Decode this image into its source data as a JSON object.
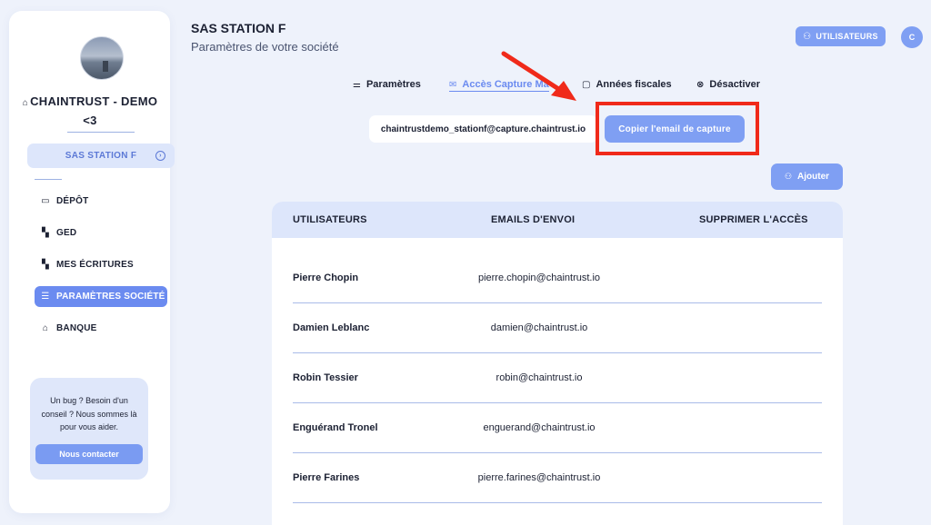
{
  "sidebar": {
    "company_name": "CHAINTRUST - DEMO <3",
    "selected_company": "SAS STATION F",
    "nav": [
      {
        "label": "DÉPÔT",
        "icon": "folder-icon",
        "active": false
      },
      {
        "label": "GED",
        "icon": "document-icon",
        "active": false
      },
      {
        "label": "MES ÉCRITURES",
        "icon": "document-icon",
        "active": false
      },
      {
        "label": "PARAMÈTRES SOCIÉTÉ",
        "icon": "sliders-icon",
        "active": true
      },
      {
        "label": "BANQUE",
        "icon": "bank-icon",
        "active": false
      }
    ],
    "help": {
      "text": "Un bug ? Besoin d'un conseil ? Nous sommes là pour vous aider.",
      "button": "Nous contacter"
    }
  },
  "header": {
    "title": "SAS STATION F",
    "subtitle": "Paramètres de votre société",
    "users_button": "UTILISATEURS",
    "user_initial": "C"
  },
  "tabs": [
    {
      "label": "Paramètres",
      "icon": "sliders-icon",
      "active": false
    },
    {
      "label": "Accès Capture Ma",
      "icon": "mail-icon",
      "active": true
    },
    {
      "label": "Années fiscales",
      "icon": "calendar-icon",
      "active": false
    },
    {
      "label": "Désactiver",
      "icon": "close-circle-icon",
      "active": false
    }
  ],
  "capture": {
    "email": "chaintrustdemo_stationf@capture.chaintrust.io",
    "copy_button": "Copier l'email de capture"
  },
  "add_button": "Ajouter",
  "table": {
    "headers": [
      "UTILISATEURS",
      "EMAILS D'ENVOI",
      "SUPPRIMER L'ACCÈS"
    ],
    "rows": [
      {
        "name": "Pierre Chopin",
        "email": "pierre.chopin@chaintrust.io"
      },
      {
        "name": "Damien Leblanc",
        "email": "damien@chaintrust.io"
      },
      {
        "name": "Robin Tessier",
        "email": "robin@chaintrust.io"
      },
      {
        "name": "Enguérand Tronel",
        "email": "enguerand@chaintrust.io"
      },
      {
        "name": "Pierre Farines",
        "email": "pierre.farines@chaintrust.io"
      }
    ]
  },
  "colors": {
    "accent": "#7f9ff3",
    "annotation": "#f02a1a"
  }
}
